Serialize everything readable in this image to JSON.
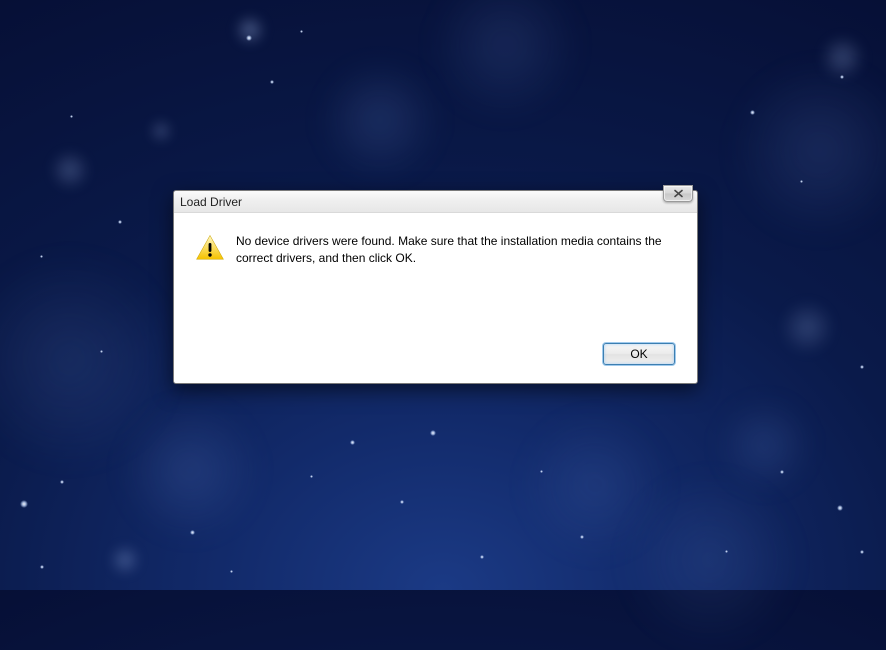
{
  "dialog": {
    "title": "Load Driver",
    "message": "No device drivers were found. Make sure that the installation media contains the correct drivers, and then click OK.",
    "ok_label": "OK"
  }
}
